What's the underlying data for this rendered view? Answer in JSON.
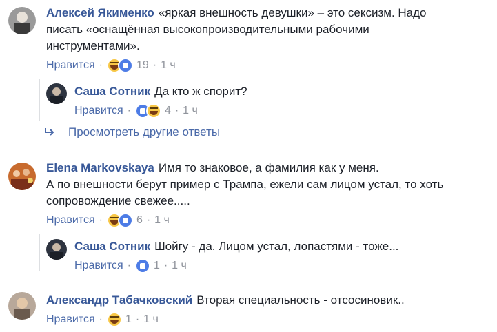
{
  "colors": {
    "author": "#385898",
    "link": "#4b6aa9",
    "meta": "#90949c",
    "text": "#1d2129"
  },
  "comments": [
    {
      "author": "Алексей Якименко",
      "lines": [
        "«яркая внешность девушки» – это сексизм. Надо",
        "писать «оснащённая высокопроизводительными рабочими",
        "инструментами»."
      ],
      "like_label": "Нравится",
      "reactions": [
        "haha-icon",
        "like-icon"
      ],
      "count": "19",
      "time": "1 ч"
    },
    {
      "author": "Саша Сотник",
      "lines": [
        "Да кто ж спорит?"
      ],
      "like_label": "Нравится",
      "reactions": [
        "like-icon",
        "haha-icon"
      ],
      "count": "4",
      "time": "1 ч"
    },
    {
      "author": "Elena Markovskaya",
      "lines": [
        "Имя то знаковое, а фамилия как у меня.",
        "А по внешности берут пример с Трампа, ежели сам лицом устал, то хоть",
        "сопровождение свежее....."
      ],
      "like_label": "Нравится",
      "reactions": [
        "haha-icon",
        "like-icon"
      ],
      "count": "6",
      "time": "1 ч"
    },
    {
      "author": "Саша Сотник",
      "lines": [
        "Шойгу - да. Лицом устал, лопастями - тоже..."
      ],
      "like_label": "Нравится",
      "reactions": [
        "like-icon"
      ],
      "count": "1",
      "time": "1 ч"
    },
    {
      "author": "Александр Табачковский",
      "lines": [
        "Вторая специальность - отсосиновик.."
      ],
      "like_label": "Нравится",
      "reactions": [
        "haha-icon"
      ],
      "count": "1",
      "time": "1 ч"
    }
  ],
  "more_replies": "Просмотреть другие ответы",
  "separator": "·"
}
